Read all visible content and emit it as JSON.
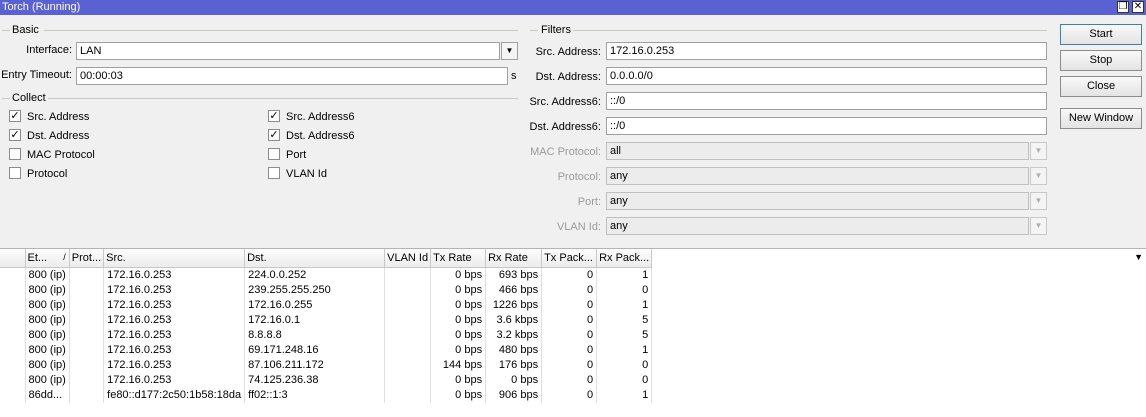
{
  "window": {
    "title": "Torch (Running)",
    "restore_icon": "restore-icon",
    "close_icon": "close-icon"
  },
  "basic": {
    "title": "Basic",
    "interface_label": "Interface:",
    "interface_value": "LAN",
    "entry_timeout_label": "Entry Timeout:",
    "entry_timeout_value": "00:00:03",
    "entry_timeout_unit": "s"
  },
  "collect": {
    "title": "Collect",
    "items": [
      {
        "label": "Src. Address",
        "checked": true
      },
      {
        "label": "Dst. Address",
        "checked": true
      },
      {
        "label": "MAC Protocol",
        "checked": false
      },
      {
        "label": "Protocol",
        "checked": false
      },
      {
        "label": "Src. Address6",
        "checked": true
      },
      {
        "label": "Dst. Address6",
        "checked": true
      },
      {
        "label": "Port",
        "checked": false
      },
      {
        "label": "VLAN Id",
        "checked": false
      }
    ]
  },
  "filters": {
    "title": "Filters",
    "src_address_label": "Src. Address:",
    "src_address_value": "172.16.0.253",
    "dst_address_label": "Dst. Address:",
    "dst_address_value": "0.0.0.0/0",
    "src_address6_label": "Src. Address6:",
    "src_address6_value": "::/0",
    "dst_address6_label": "Dst. Address6:",
    "dst_address6_value": "::/0",
    "mac_protocol_label": "MAC Protocol:",
    "mac_protocol_value": "all",
    "protocol_label": "Protocol:",
    "protocol_value": "any",
    "port_label": "Port:",
    "port_value": "any",
    "vlan_id_label": "VLAN Id:",
    "vlan_id_value": "any"
  },
  "buttons": {
    "start": "Start",
    "stop": "Stop",
    "close": "Close",
    "new_window": "New Window"
  },
  "table": {
    "columns": [
      "Et...",
      "Prot...",
      "Src.",
      "Dst.",
      "VLAN Id",
      "Tx Rate",
      "Rx Rate",
      "Tx Pack...",
      "Rx Pack..."
    ],
    "sort_indicator": "/",
    "rows": [
      [
        "800 (ip)",
        "",
        "172.16.0.253",
        "224.0.0.252",
        "",
        "0 bps",
        "693 bps",
        "0",
        "1"
      ],
      [
        "800 (ip)",
        "",
        "172.16.0.253",
        "239.255.255.250",
        "",
        "0 bps",
        "466 bps",
        "0",
        "0"
      ],
      [
        "800 (ip)",
        "",
        "172.16.0.253",
        "172.16.0.255",
        "",
        "0 bps",
        "1226 bps",
        "0",
        "1"
      ],
      [
        "800 (ip)",
        "",
        "172.16.0.253",
        "172.16.0.1",
        "",
        "0 bps",
        "3.6 kbps",
        "0",
        "5"
      ],
      [
        "800 (ip)",
        "",
        "172.16.0.253",
        "8.8.8.8",
        "",
        "0 bps",
        "3.2 kbps",
        "0",
        "5"
      ],
      [
        "800 (ip)",
        "",
        "172.16.0.253",
        "69.171.248.16",
        "",
        "0 bps",
        "480 bps",
        "0",
        "1"
      ],
      [
        "800 (ip)",
        "",
        "172.16.0.253",
        "87.106.211.172",
        "",
        "144 bps",
        "176 bps",
        "0",
        "0"
      ],
      [
        "800 (ip)",
        "",
        "172.16.0.253",
        "74.125.236.38",
        "",
        "0 bps",
        "0 bps",
        "0",
        "0"
      ],
      [
        "86dd...",
        "",
        "fe80::d177:2c50:1b58:18da",
        "ff02::1:3",
        "",
        "0 bps",
        "906 bps",
        "0",
        "1"
      ]
    ]
  }
}
